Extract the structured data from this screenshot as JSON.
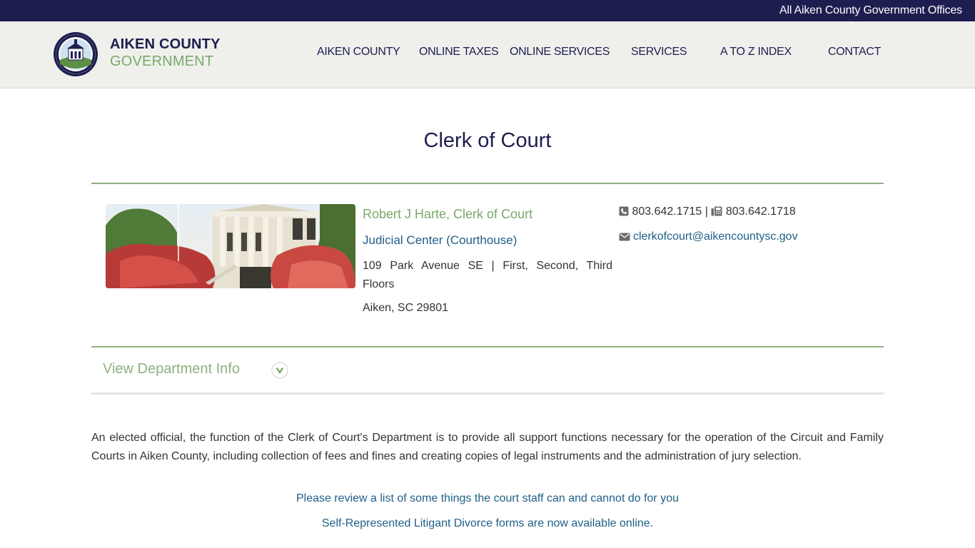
{
  "ticker": {
    "text": "All Aiken County Government Offices"
  },
  "header": {
    "logo_line1": "AIKEN COUNTY",
    "logo_line2": "GOVERNMENT",
    "seal_text_top": "AIKEN COUNTY",
    "seal_text_bottom": "SOUTH CAROLINA",
    "seal_year": "1871"
  },
  "nav": {
    "items": [
      {
        "label": "AIKEN COUNTY"
      },
      {
        "label": "ONLINE TAXES"
      },
      {
        "label": "ONLINE SERVICES"
      },
      {
        "label": "SERVICES"
      },
      {
        "label": "A TO Z INDEX"
      },
      {
        "label": "CONTACT"
      }
    ]
  },
  "page": {
    "title": "Clerk of Court"
  },
  "contact": {
    "name": "Robert J Harte, Clerk of Court",
    "location_link": "Judicial Center (Courthouse)",
    "address_line1": "109 Park Avenue SE | First, Second, Third",
    "address_line2": "Floors",
    "city": "Aiken, SC 29801",
    "phone": "803.642.1715",
    "separator": "|",
    "fax": "803.642.1718",
    "email": "clerkofcourt@aikencountysc.gov"
  },
  "department": {
    "toggle_label": "View Department Info"
  },
  "content": {
    "description": "An elected official, the function of the Clerk of Court's Department is to provide all support functions necessary for the operation of the Circuit and Family Courts in Aiken County, including collection of fees and fines and creating copies of legal instruments and the administration of jury selection.",
    "link1": "Please review a list of some things the court staff can and cannot do for you",
    "link2": "Self-Represented Litigant Divorce forms are now available online."
  },
  "colors": {
    "navy": "#1e1d4f",
    "green": "#7aa86a",
    "link_blue": "#1f5f87",
    "header_bg": "#eff0ec"
  },
  "icons": [
    "county-seal-logo",
    "phone-icon",
    "fax-icon",
    "envelope-icon",
    "chevron-down-icon"
  ]
}
